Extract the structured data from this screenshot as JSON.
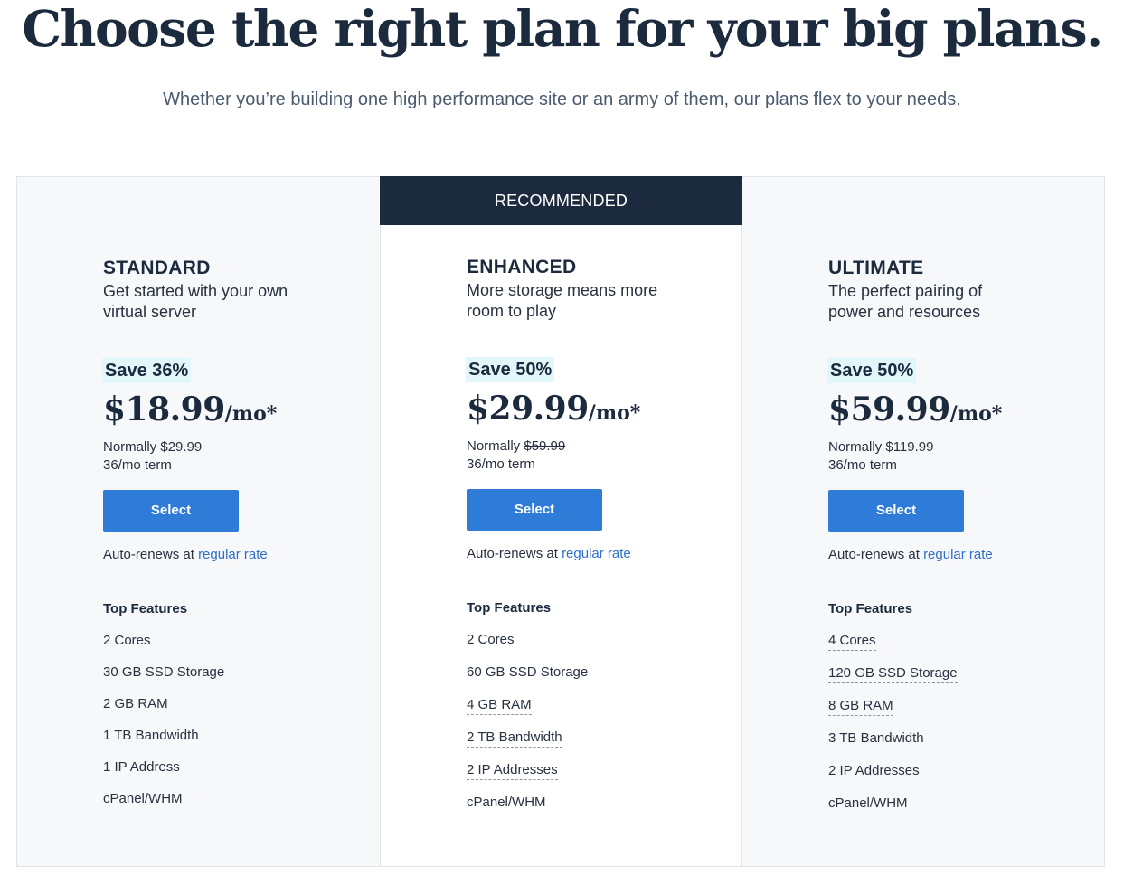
{
  "header": {
    "title": "Choose the right plan for your big plans.",
    "subtitle": "Whether you’re building one high performance site or an army of them, our plans flex to your needs."
  },
  "recommended_label": "RECOMMENDED",
  "colors": {
    "navy": "#1c2a3e",
    "button_blue": "#2e7bd8",
    "save_highlight": "#e1f7fa",
    "link_blue": "#2f6fc9"
  },
  "plans": [
    {
      "name": "STANDARD",
      "desc": "Get started with your own virtual server",
      "save": "Save 36%",
      "price": "$18.99",
      "per": "/mo*",
      "normally_label": "Normally",
      "normal_price": "$29.99",
      "term": "36/mo term",
      "select_label": "Select",
      "renew_prefix": "Auto-renews at",
      "renew_link": "regular rate",
      "features_title": "Top Features",
      "features": [
        "2 Cores",
        "30 GB SSD Storage",
        "2 GB RAM",
        "1 TB Bandwidth",
        "1 IP Address",
        "cPanel/WHM"
      ]
    },
    {
      "name": "ENHANCED",
      "desc": "More storage means more room to play",
      "save": "Save 50%",
      "price": "$29.99",
      "per": "/mo*",
      "normally_label": "Normally",
      "normal_price": "$59.99",
      "term": "36/mo term",
      "select_label": "Select",
      "renew_prefix": "Auto-renews at",
      "renew_link": "regular rate",
      "features_title": "Top Features",
      "features": [
        "2 Cores",
        "60 GB SSD Storage",
        "4 GB RAM",
        "2 TB Bandwidth",
        "2 IP Addresses",
        "cPanel/WHM"
      ]
    },
    {
      "name": "ULTIMATE",
      "desc": "The perfect pairing of power and resources",
      "save": "Save 50%",
      "price": "$59.99",
      "per": "/mo*",
      "normally_label": "Normally",
      "normal_price": "$119.99",
      "term": "36/mo term",
      "select_label": "Select",
      "renew_prefix": "Auto-renews at",
      "renew_link": "regular rate",
      "features_title": "Top Features",
      "features": [
        "4 Cores",
        "120 GB SSD Storage",
        "8 GB RAM",
        "3 TB Bandwidth",
        "2 IP Addresses",
        "cPanel/WHM"
      ]
    }
  ]
}
